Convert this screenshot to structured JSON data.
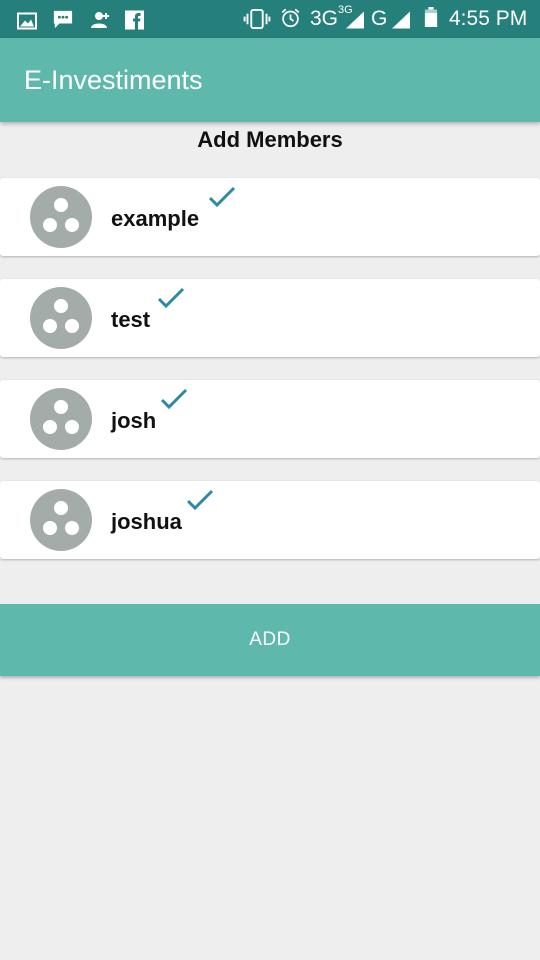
{
  "status_bar": {
    "network": "3G",
    "network_superscript": "3G",
    "carrier_letter": "G",
    "time": "4:55 PM",
    "icons": [
      "image-icon",
      "message-icon",
      "person-add-icon",
      "facebook-icon",
      "vibrate-icon",
      "alarm-icon",
      "signal-icon",
      "signal-icon",
      "battery-icon"
    ]
  },
  "app_bar": {
    "title": "E-Investiments"
  },
  "section": {
    "title": "Add Members"
  },
  "members": [
    {
      "name": "example",
      "checked": true
    },
    {
      "name": "test",
      "checked": true
    },
    {
      "name": "josh",
      "checked": true
    },
    {
      "name": "joshua",
      "checked": true
    }
  ],
  "actions": {
    "add_label": "ADD"
  },
  "colors": {
    "status_bar": "#25807b",
    "app_bar": "#5fb8ac",
    "background": "#eeeeee",
    "avatar": "#a3aca8",
    "check": "#2e88a8"
  }
}
